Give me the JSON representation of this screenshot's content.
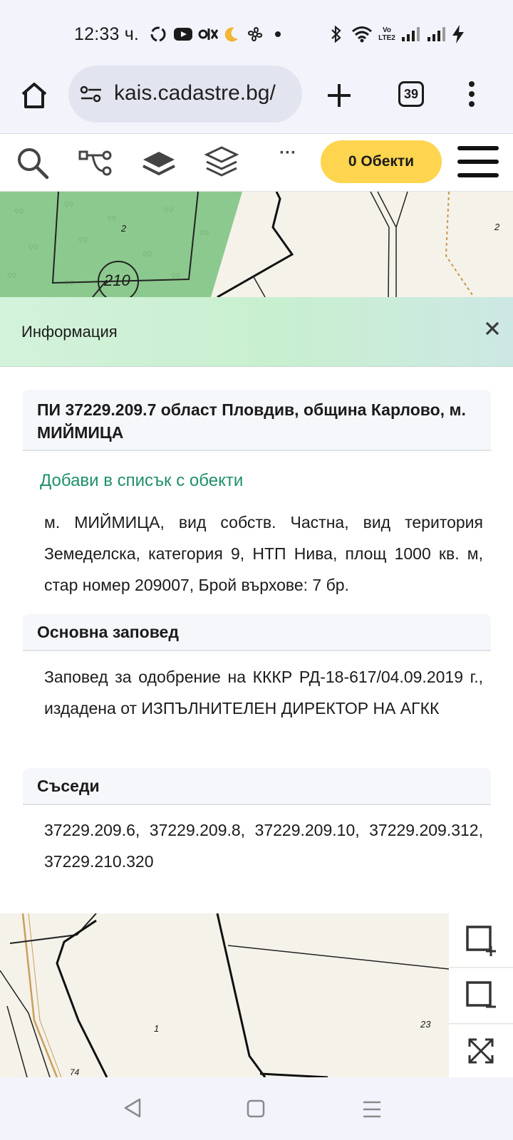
{
  "status_bar": {
    "time": "12:33 ч.",
    "icons": [
      "sync-icon",
      "youtube-icon",
      "olx-icon",
      "moon-icon",
      "fan-icon",
      "dot-icon",
      "bluetooth-icon",
      "wifi-icon",
      "volte-icon",
      "signal-icon",
      "signal-icon",
      "charging-icon"
    ]
  },
  "browser": {
    "url": "kais.cadastre.bg/",
    "tab_count": "39"
  },
  "toolbar": {
    "objects_button": "0 Обекти",
    "more_label": "···"
  },
  "map_top": {
    "labels": [
      "2",
      "210",
      "2"
    ]
  },
  "info_panel": {
    "title": "Информация",
    "parcel_title": "ПИ 37229.209.7 област Пловдив, община Карлово, м. МИЙМИЦА",
    "add_link": "Добави в списък с обекти",
    "parcel_description": "м. МИЙМИЦА, вид собств. Частна, вид територия Земеделска, категория 9, НТП Нива, площ 1000 кв. м, стар номер 209007, Брой върхове: 7 бр.",
    "order_heading": "Основна заповед",
    "order_text": "Заповед за одобрение на КККР РД-18-617/04.09.2019 г., издадена от ИЗПЪЛНИТЕЛЕН ДИРЕКТОР НА АГКК",
    "neighbours_heading": "Съседи",
    "neighbours_text": "37229.209.6, 37229.209.8, 37229.209.10, 37229.209.312, 37229.210.320"
  },
  "map_bottom": {
    "labels": [
      "1",
      "23",
      "74"
    ]
  },
  "colors": {
    "accent_yellow": "#ffd54f",
    "link_green": "#1f8f6a",
    "forest_green": "#8cc98e",
    "header_mint": "#cdf0d6"
  }
}
